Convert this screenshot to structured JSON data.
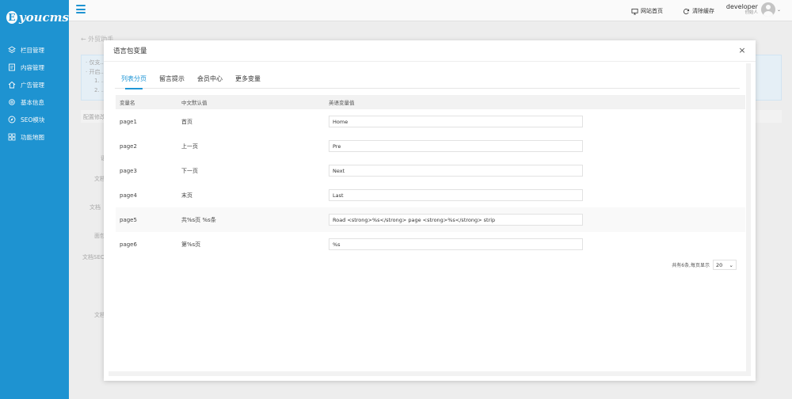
{
  "brand": {
    "logo_letter": "E",
    "logo_text": "youcms"
  },
  "sidebar": {
    "items": [
      {
        "label": "栏目管理",
        "icon": "layers-icon"
      },
      {
        "label": "内容管理",
        "icon": "document-icon"
      },
      {
        "label": "广告管理",
        "icon": "home-icon"
      },
      {
        "label": "基本信息",
        "icon": "gear-icon"
      },
      {
        "label": "SEO模块",
        "icon": "compass-icon"
      },
      {
        "label": "功能地图",
        "icon": "grid-icon"
      }
    ]
  },
  "header": {
    "site_home": "网站首页",
    "clear_cache": "清除缓存",
    "user_name": "developer",
    "user_role": "创始人"
  },
  "background": {
    "back_label": "外贸助手",
    "lines": [
      "· 仅支...",
      "· 开启...",
      "1. ...",
      "2. ..."
    ],
    "config_label": "配置修改",
    "labels": [
      "语",
      "文档",
      "文档",
      "面包",
      "文档SEO",
      "文档"
    ]
  },
  "modal": {
    "title": "语言包变量",
    "close": "×",
    "tabs": [
      "列表分页",
      "留言提示",
      "会员中心",
      "更多变量"
    ],
    "columns": [
      "变量名",
      "中文默认值",
      "英语变量值"
    ],
    "rows": [
      {
        "name": "page1",
        "cn": "首页",
        "en": "Home"
      },
      {
        "name": "page2",
        "cn": "上一页",
        "en": "Pre"
      },
      {
        "name": "page3",
        "cn": "下一页",
        "en": "Next"
      },
      {
        "name": "page4",
        "cn": "末页",
        "en": "Last"
      },
      {
        "name": "page5",
        "cn": "共%s页 %s条",
        "en": "Road <strong>%s</strong> page <strong>%s</strong> strip"
      },
      {
        "name": "page6",
        "cn": "第%s页",
        "en": "%s"
      }
    ],
    "pager_text": "共有6条,每页显示",
    "page_size": "20"
  },
  "colors": {
    "accent": "#1f96d6"
  }
}
